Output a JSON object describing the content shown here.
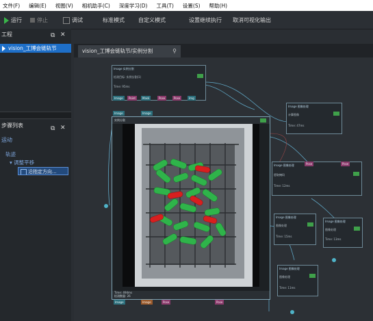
{
  "menu": [
    "文件(F)",
    "编辑(E)",
    "视图(V)",
    "相机助手(C)",
    "深度学习(D)",
    "工具(T)",
    "设置(S)",
    "帮助(H)"
  ],
  "toolbar": {
    "run": "运行",
    "stop": "停止",
    "debug": "调试",
    "standard_mode": "标准模式",
    "custom_mode": "自定义模式",
    "continue_run": "设置继续执行",
    "cancel_vis": "取消可视化输出"
  },
  "left_panel": {
    "project_title": "工程",
    "project_item": "vision_工博会链轨节",
    "steps_title": "步骤列表",
    "steps_sub": "运动",
    "tree_level1": "轨迹",
    "tree_level2": "调整平移",
    "tree_level3": "沿指定方向..."
  },
  "tab": {
    "label": "vision_工博会链轨节/实例分割"
  },
  "nodes": {
    "n1": {
      "title": "Image\n实例分割",
      "body": "检测目标: 实例分割(1)",
      "time": "Time: 95ms"
    },
    "n2": {
      "title": "Image\n图像处理",
      "body": "计算图像",
      "time": "Time: 47ms"
    },
    "n3": {
      "title": "Image\n图像处理",
      "body": "提取掩码",
      "time": "Time: 12ms"
    },
    "n4": {
      "title": "Image\n图像处理",
      "body": "图像处理",
      "time": "Time: 15ms"
    },
    "n5": {
      "title": "Image\n图像处理",
      "body": "图像处理",
      "time": "Time: 13ms"
    },
    "n6": {
      "title": "Image\n图像处理",
      "body": "图像处理",
      "time": "Time: 11ms"
    },
    "n7": {
      "title": "Image\n图像处理",
      "body": "图像处理",
      "time": "Time: 10ms"
    }
  },
  "viewer": {
    "header": "实例分割",
    "footer1": "Time: 494ms",
    "footer2": "检测数量: 26"
  },
  "colors": {
    "accent": "#1e6fc8",
    "green": "#2fb44a",
    "red": "#d81f1f",
    "link": "#6fb6d3"
  }
}
